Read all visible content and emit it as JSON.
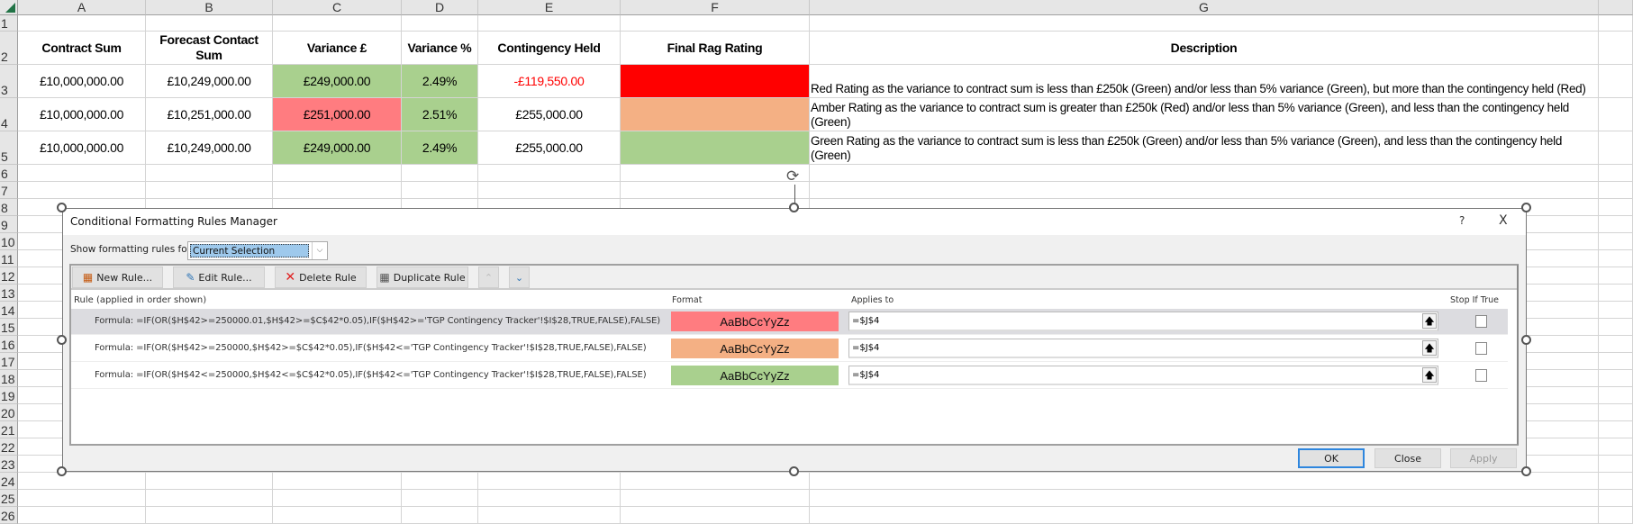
{
  "sheet": {
    "columns": [
      "A",
      "B",
      "C",
      "D",
      "E",
      "F",
      "G"
    ],
    "row_numbers": [
      "1",
      "2",
      "3",
      "4",
      "5",
      "6",
      "7",
      "8",
      "9",
      "10",
      "11",
      "12",
      "13",
      "14",
      "15",
      "16",
      "17",
      "18",
      "19",
      "20",
      "21",
      "22",
      "23",
      "24",
      "25",
      "26"
    ],
    "headers": {
      "a": "Contract Sum",
      "b": "Forecast Contact Sum",
      "c": "Variance £",
      "d": "Variance %",
      "e": "Contingency Held",
      "f": "Final Rag Rating",
      "g": "Description"
    },
    "rows": [
      {
        "a": "£10,000,000.00",
        "b": "£10,249,000.00",
        "c": "£249,000.00",
        "d": "2.49%",
        "e": "-£119,550.00",
        "g": " Red Rating as the variance to contract sum is less than £250k (Green) and/or less than  5% variance (Green), but more than the contingency held (Red)",
        "c_color": "#a9d08e",
        "f_color": "#ff0000",
        "e_color": "#ff0000"
      },
      {
        "a": "£10,000,000.00",
        "b": "£10,251,000.00",
        "c": "£251,000.00",
        "d": "2.51%",
        "e": "£255,000.00",
        "g": " Amber Rating as the variance to contract sum is greater than £250k (Red) and/or less than  5% variance (Green), and less than the contingency held (Green)",
        "c_color": "#ff7c80",
        "f_color": "#f4b084",
        "e_color": "#000000"
      },
      {
        "a": "£10,000,000.00",
        "b": "£10,249,000.00",
        "c": "£249,000.00",
        "d": "2.49%",
        "e": "£255,000.00",
        "g": " Green Rating as the variance to contract sum is less than £250k (Green) and/or less than  5% variance (Green), and less than the contingency held (Green)",
        "c_color": "#a9d08e",
        "f_color": "#a9d08e",
        "e_color": "#000000"
      }
    ],
    "d_color": "#a9d08e"
  },
  "dialog": {
    "title": "Conditional Formatting Rules Manager",
    "help": "?",
    "close_x": "X",
    "show_rules_label": "Show formatting rules for:",
    "show_rules_value": "Current Selection",
    "toolbar": {
      "new_rule": "New Rule...",
      "edit_rule": "Edit Rule...",
      "delete_rule": "Delete Rule",
      "duplicate_rule": "Duplicate Rule"
    },
    "columns": {
      "rule": "Rule (applied in order shown)",
      "format": "Format",
      "applies_to": "Applies to",
      "stop_if_true": "Stop If True"
    },
    "rules": [
      {
        "formula": "Formula: =IF(OR($H$42>=250000.01,$H$42>=$C$42*0.05),IF($H$42>='TGP Contingency Tracker'!$I$28,TRUE,FALSE),FALSE)",
        "preview": "AaBbCcYyZz",
        "color": "#ff7c80",
        "applies_to": "=$J$4"
      },
      {
        "formula": "Formula: =IF(OR($H$42>=250000,$H$42>=$C$42*0.05),IF($H$42<='TGP Contingency Tracker'!$I$28,TRUE,FALSE),FALSE)",
        "preview": "AaBbCcYyZz",
        "color": "#f4b084",
        "applies_to": "=$J$4"
      },
      {
        "formula": "Formula: =IF(OR($H$42<=250000,$H$42<=$C$42*0.05),IF($H$42<='TGP Contingency Tracker'!$I$28,TRUE,FALSE),FALSE)",
        "preview": "AaBbCcYyZz",
        "color": "#a9d08e",
        "applies_to": "=$J$4"
      }
    ],
    "buttons": {
      "ok": "OK",
      "close": "Close",
      "apply": "Apply"
    }
  }
}
